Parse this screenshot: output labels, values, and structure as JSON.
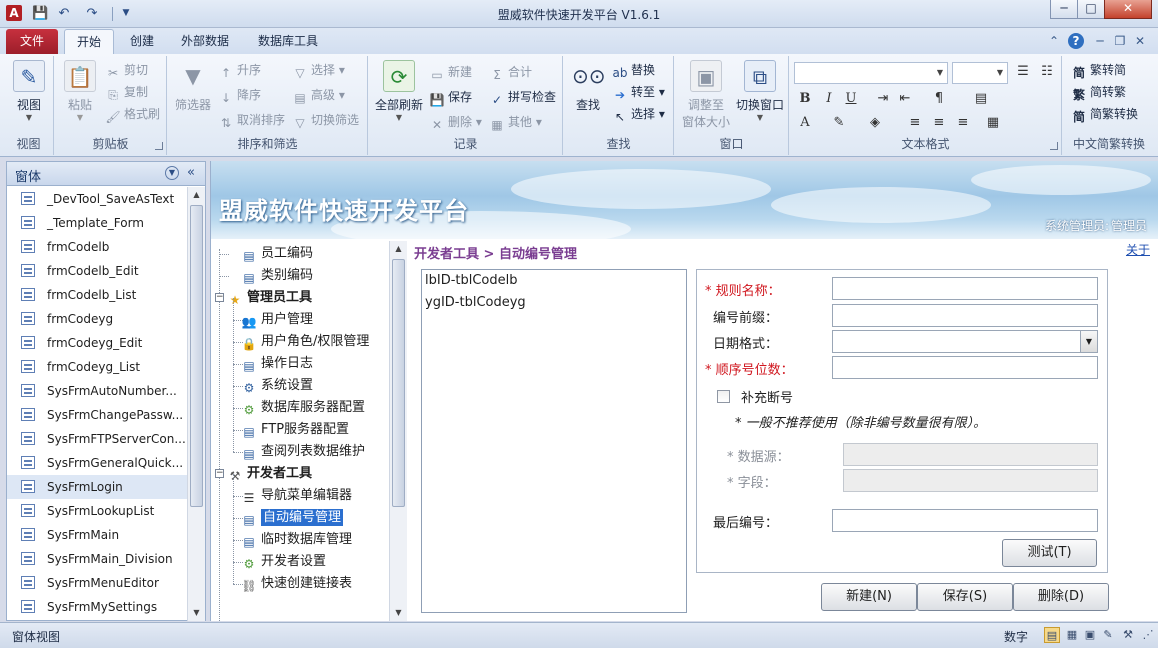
{
  "window": {
    "title": "盟威软件快速开发平台 V1.6.1",
    "app_logo": "A",
    "min_label": "─",
    "max_label": "□",
    "close_label": "✕"
  },
  "quick_access": [
    "save-icon",
    "undo-icon",
    "redo-icon",
    "customize-icon"
  ],
  "tabs": {
    "file": "文件",
    "items": [
      "开始",
      "创建",
      "外部数据",
      "数据库工具"
    ],
    "active": "开始"
  },
  "ribbon": {
    "view": {
      "big": "视图",
      "group": "视图"
    },
    "clipboard": {
      "paste": "粘贴",
      "cut": "剪切",
      "copy": "复制",
      "format_painter": "格式刷",
      "group": "剪贴板"
    },
    "sort_filter": {
      "filter": "筛选器",
      "asc": "升序",
      "desc": "降序",
      "clear_sort": "取消排序",
      "select": "选择",
      "advanced": "高级",
      "toggle_filter": "切换筛选",
      "group": "排序和筛选"
    },
    "records": {
      "refresh_all": "全部刷新",
      "new": "新建",
      "save": "保存",
      "delete": "删除",
      "totals": "合计",
      "spelling": "拼写检查",
      "other": "其他",
      "group": "记录"
    },
    "find": {
      "find": "查找",
      "replace": "替换",
      "goto": "转至",
      "select": "选择",
      "group": "查找"
    },
    "window": {
      "size_to_fit": "调整至",
      "size_to_fit_2": "窗体大小",
      "switch": "切换窗口",
      "group": "窗口"
    },
    "text_format": {
      "group": "文本格式",
      "bold": "B",
      "italic": "I",
      "underline": "U",
      "font_color": "A"
    },
    "chinese_convert": {
      "to_simplified": "繁转简",
      "to_traditional": "简转繁",
      "convert": "简繁转换",
      "group": "中文简繁转换",
      "prefix_1": "简",
      "prefix_2": "繁",
      "prefix_3": "简"
    }
  },
  "nav": {
    "title": "窗体",
    "items": [
      "_DevTool_SaveAsText",
      "_Template_Form",
      "frmCodelb",
      "frmCodelb_Edit",
      "frmCodelb_List",
      "frmCodeyg",
      "frmCodeyg_Edit",
      "frmCodeyg_List",
      "SysFrmAutoNumber...",
      "SysFrmChangePassw...",
      "SysFrmFTPServerCon...",
      "SysFrmGeneralQuick...",
      "SysFrmLogin",
      "SysFrmLookupList",
      "SysFrmMain",
      "SysFrmMain_Division",
      "SysFrmMenuEditor",
      "SysFrmMySettings"
    ],
    "selected_index": 12
  },
  "banner": {
    "title": "盟威软件快速开发平台",
    "user_label": "系统管理员:",
    "user_name": "管理员"
  },
  "tree": {
    "items": [
      {
        "label": "员工编码",
        "icon": "document-icon",
        "level": 1
      },
      {
        "label": "类别编码",
        "icon": "document-icon",
        "level": 1
      },
      {
        "label": "管理员工具",
        "icon": "star-icon",
        "level": 0,
        "bold": true
      },
      {
        "label": "用户管理",
        "icon": "users-icon",
        "level": 1
      },
      {
        "label": "用户角色/权限管理",
        "icon": "lock-icon",
        "level": 1
      },
      {
        "label": "操作日志",
        "icon": "document-icon",
        "level": 1
      },
      {
        "label": "系统设置",
        "icon": "settings-doc-icon",
        "level": 1
      },
      {
        "label": "数据库服务器配置",
        "icon": "gears-icon",
        "level": 1
      },
      {
        "label": "FTP服务器配置",
        "icon": "document-icon",
        "level": 1
      },
      {
        "label": "查阅列表数据维护",
        "icon": "document-icon",
        "level": 1
      },
      {
        "label": "开发者工具",
        "icon": "tools-icon",
        "level": 0,
        "bold": true
      },
      {
        "label": "导航菜单编辑器",
        "icon": "menu-icon",
        "level": 1
      },
      {
        "label": "自动编号管理",
        "icon": "document-icon",
        "level": 1,
        "selected": true
      },
      {
        "label": "临时数据库管理",
        "icon": "document-icon",
        "level": 1
      },
      {
        "label": "开发者设置",
        "icon": "gears-icon",
        "level": 1
      },
      {
        "label": "快速创建链接表",
        "icon": "link-icon",
        "level": 1
      }
    ]
  },
  "breadcrumb": "开发者工具 > 自动编号管理",
  "about_link": "关于",
  "list": [
    "lbID-tblCodelb",
    "ygID-tblCodeyg"
  ],
  "form": {
    "rule_name": "* 规则名称：",
    "prefix": "编号前缀：",
    "date_format": "日期格式：",
    "seq_digits": "* 顺序号位数：",
    "fill_gap": "补充断号",
    "note": "* 一般不推荐使用（除非编号数量很有限）。",
    "data_source": "* 数据源：",
    "field": "* 字段：",
    "last_number": "最后编号：",
    "test_button": "测试(T)",
    "new_button": "新建(N)",
    "save_button": "保存(S)",
    "delete_button": "删除(D)"
  },
  "status": {
    "left": "窗体视图",
    "right": "数字"
  }
}
